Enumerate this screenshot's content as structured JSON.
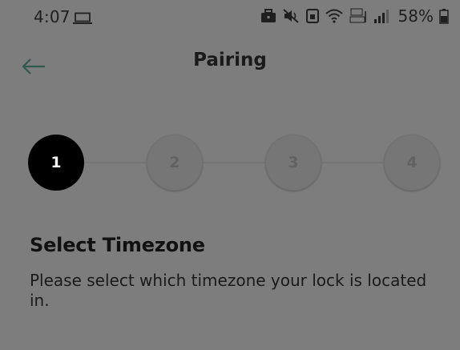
{
  "status_bar": {
    "time": "4:07",
    "battery": "58%",
    "icons": [
      "laptop-icon",
      "briefcase-icon",
      "mute-icon",
      "lock-status-icon",
      "wifi-icon",
      "volte-signal-icon",
      "cell-signal-icon",
      "battery-icon"
    ]
  },
  "app_bar": {
    "title": "Pairing",
    "back_icon": "back-arrow-icon"
  },
  "colors": {
    "overlay_background": "#7d7d7d",
    "active_step": "#000000",
    "back_arrow": "#2f5a50"
  },
  "stepper": {
    "current_step": 1,
    "steps": [
      {
        "label": "1"
      },
      {
        "label": "2"
      },
      {
        "label": "3"
      },
      {
        "label": "4"
      }
    ]
  },
  "main": {
    "title": "Select Timezone",
    "description": "Please select which timezone your lock is located in."
  }
}
